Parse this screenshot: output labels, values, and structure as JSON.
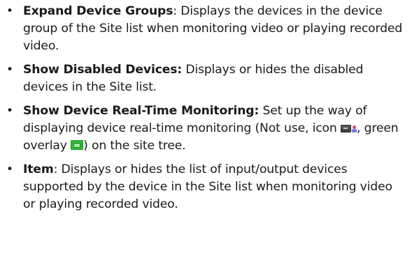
{
  "items": [
    {
      "bullet": "•",
      "term": "Expand Device Groups",
      "after_term": ":",
      "text": " Displays the devices in the device group of the Site list when monitoring video or playing recorded video."
    },
    {
      "bullet": "•",
      "term": "Show Disabled Devices:",
      "after_term": "",
      "text": " Displays or hides the disabled devices in the Site list."
    },
    {
      "bullet": "•",
      "term": "Show Device Real-Time Monitoring:",
      "after_term": "",
      "text_a": " Set up the way of displaying device real-time monitoring (Not use, icon ",
      "text_b": ", green overlay ",
      "text_c": ") on the site tree."
    },
    {
      "bullet": "•",
      "term": "Item",
      "after_term": ":",
      "text": " Displays or hides the list of input/output devices supported by the device in the Site list when monitoring video or playing recorded video."
    }
  ],
  "icons": {
    "monitoring_icon": "camera-monitoring-icon",
    "green_overlay_icon": "green-overlay-icon",
    "green": "#2fbf3a"
  }
}
